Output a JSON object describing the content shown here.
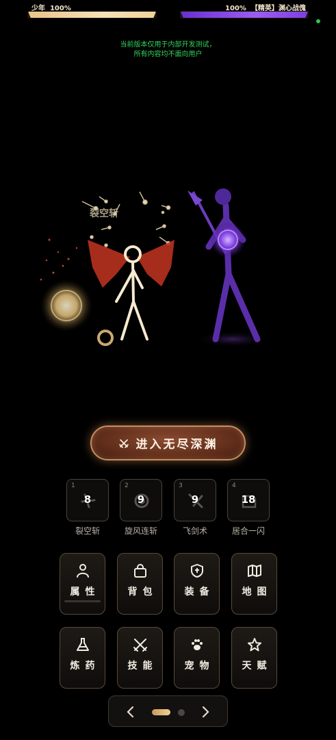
{
  "player": {
    "name": "少年",
    "hp": "100%",
    "hp_fraction": 1.0,
    "bar_color": "#f2d29a"
  },
  "enemy": {
    "hp": "100%",
    "tag": "【精英】",
    "name": "渊心战傀",
    "hp_fraction": 1.0,
    "bar_color": "#8a4ae8"
  },
  "notice": {
    "line1": "当前版本仅用于内部开发测试，",
    "line2": "所有内容均不面向用户"
  },
  "battle": {
    "skill_popup": "裂空斩"
  },
  "main_button": {
    "label": "进入无尽深渊",
    "icon": "crossed-swords-icon"
  },
  "skills": [
    {
      "index": "1",
      "cooldown": "8",
      "name": "裂空斩"
    },
    {
      "index": "2",
      "cooldown": "9",
      "name": "旋风连斩"
    },
    {
      "index": "3",
      "cooldown": "9",
      "name": "飞剑术"
    },
    {
      "index": "4",
      "cooldown": "18",
      "name": "居合一闪"
    }
  ],
  "menu": [
    {
      "label": "属性",
      "icon": "person-icon"
    },
    {
      "label": "背包",
      "icon": "bag-icon"
    },
    {
      "label": "装备",
      "icon": "shield-icon"
    },
    {
      "label": "地图",
      "icon": "map-icon"
    },
    {
      "label": "炼药",
      "icon": "flask-icon"
    },
    {
      "label": "技能",
      "icon": "crossed-swords-icon"
    },
    {
      "label": "宠物",
      "icon": "paw-icon"
    },
    {
      "label": "天赋",
      "icon": "star-icon"
    }
  ],
  "pager": {
    "current_page": 1,
    "total_pages": 2
  },
  "colors": {
    "accent_gold": "#e6c48e",
    "enemy_purple": "#7b3fe4",
    "notice_green": "#33d45c",
    "button_brown": "#6a3420"
  }
}
